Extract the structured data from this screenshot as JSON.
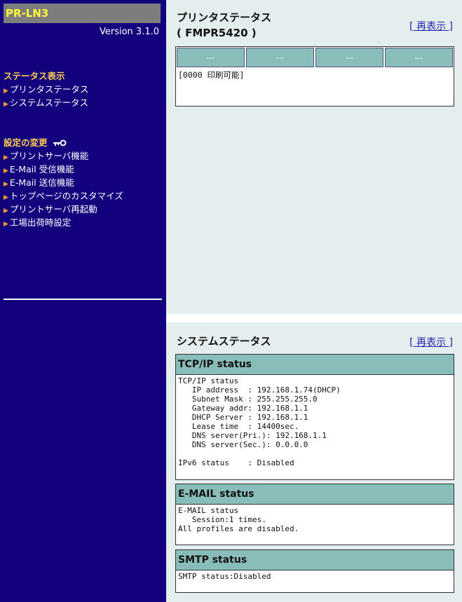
{
  "sidebar": {
    "logo": "PR-LN3",
    "version": "Version 3.1.0",
    "status_heading": "ステータス表示",
    "status_items": [
      "プリンタステータス",
      "システムステータス"
    ],
    "settings_heading": "設定の変更",
    "settings_items": [
      "プリントサーバ機能",
      "E-Mail 受信機能",
      "E-Mail 送信機能",
      "トップページのカスタマイズ",
      "プリントサーバ再起動",
      "工場出荷時設定"
    ]
  },
  "printer": {
    "title_line1": "プリンタステータス",
    "title_line2": "( FMPR5420 )",
    "reload": "[ 再表示 ]",
    "cells": [
      "---",
      "---",
      "---",
      "---"
    ],
    "message": "[0000 印刷可能]"
  },
  "system": {
    "title": "システムステータス",
    "reload": "[ 再表示 ]",
    "tcpip": {
      "header": "TCP/IP status",
      "body": "TCP/IP status\n   IP address  : 192.168.1.74(DHCP)\n   Subnet Mask : 255.255.255.0\n   Gateway addr: 192.168.1.1\n   DHCP Server : 192.168.1.1\n   Lease time  : 14400sec.\n   DNS server(Pri.): 192.168.1.1\n   DNS server(Sec.): 0.0.0.0\n\nIPv6 status    : Disabled"
    },
    "email": {
      "header": "E-MAIL status",
      "body": "E-MAIL status\n   Session:1 times.\nAll profiles are disabled."
    },
    "smtp": {
      "header": "SMTP status",
      "body": "SMTP status:Disabled"
    }
  },
  "colors": {
    "sidebar_bg": "#13007c",
    "header_teal": "#88bdb9",
    "main_bg": "#e4eeee",
    "logo_text": "#ffff3c"
  }
}
